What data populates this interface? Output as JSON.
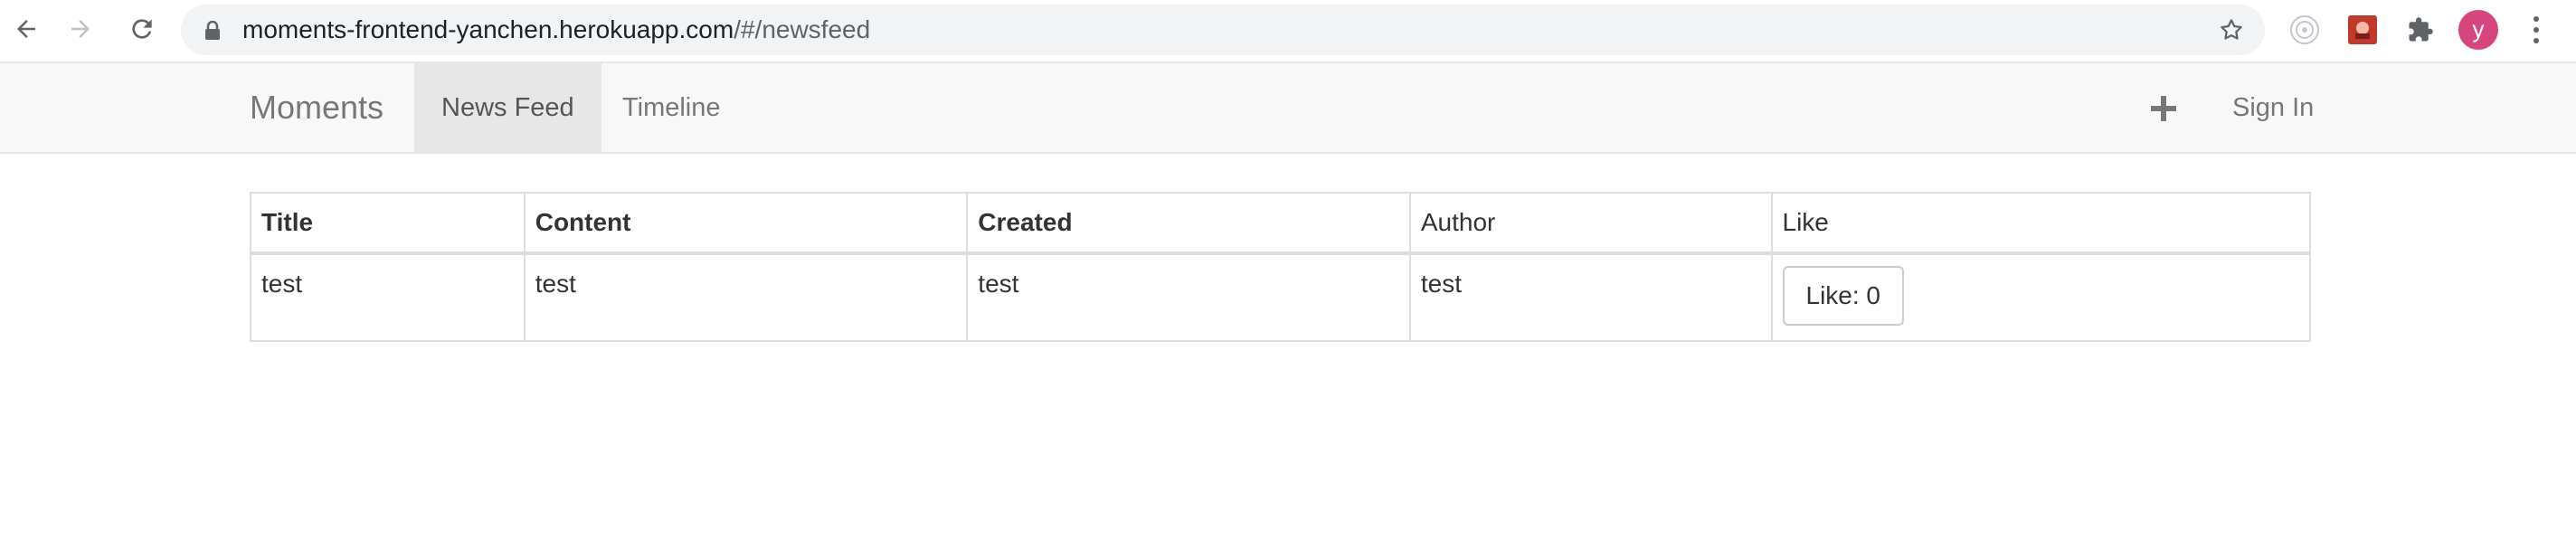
{
  "browser": {
    "url_host": "moments-frontend-yanchen.herokuapp.com",
    "url_path": "/#/newsfeed",
    "profile_initial": "y",
    "icons": {
      "back": "arrow-left-icon",
      "forward": "arrow-right-icon",
      "reload": "reload-icon",
      "lock": "lock-icon",
      "bookmark": "star-icon",
      "extensions": [
        "target-extension-icon",
        "red-extension-icon",
        "puzzle-icon"
      ],
      "menu": "more-vert-icon"
    }
  },
  "navbar": {
    "brand": "Moments",
    "tabs": [
      {
        "label": "News Feed",
        "active": true
      },
      {
        "label": "Timeline",
        "active": false
      }
    ],
    "add_icon": "plus-icon",
    "sign_in": "Sign In"
  },
  "table": {
    "headers": [
      "Title",
      "Content",
      "Created",
      "Author",
      "Like"
    ],
    "rows": [
      {
        "title": "test",
        "content": "test",
        "created": "test",
        "author": "test",
        "like_label": "Like: 0"
      }
    ]
  },
  "colors": {
    "navbar_bg": "#f8f8f8",
    "active_tab_bg": "#e7e7e7",
    "profile_avatar": "#d6467d",
    "table_border": "#dddddd"
  }
}
